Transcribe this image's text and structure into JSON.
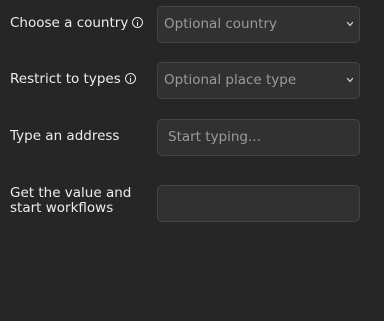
{
  "form": {
    "country": {
      "label": "Choose a country",
      "placeholder": "Optional country"
    },
    "types": {
      "label": "Restrict to types",
      "placeholder": "Optional place type"
    },
    "address": {
      "label": "Type an address",
      "placeholder": "Start typing..."
    },
    "value": {
      "label_line1": "Get the value and",
      "label_line2": "start workflows",
      "value": ""
    }
  },
  "icons": {
    "info": "info-icon",
    "select_arrow": "chevron-down-icon"
  },
  "colors": {
    "background": "#262626",
    "field_background": "#313131",
    "field_border": "#444444",
    "label_text": "#ededed",
    "placeholder_text": "#9a9a9a"
  }
}
